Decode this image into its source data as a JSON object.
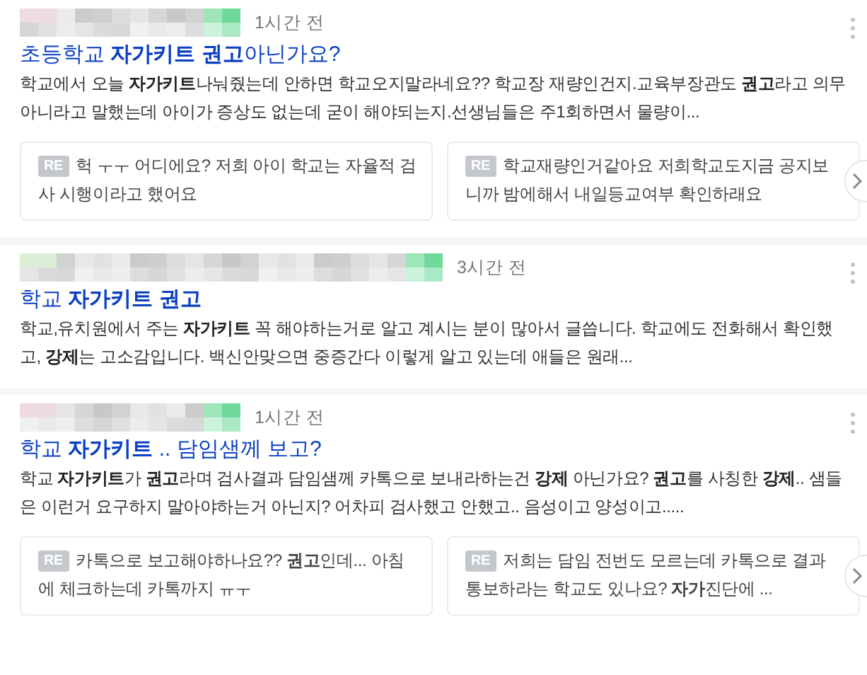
{
  "posts": [
    {
      "time": "1시간 전",
      "title": "초등학교 **자가키트 권고**아닌가요?",
      "snippet": "학교에서 오늘 **자가키트**나눠줬는데 안하면 학교오지말라네요?? 학교장 재량인건지.교육부장관도 **권고**라고 의무아니라고 말했는데 아이가 증상도 없는데 굳이 해야되는지.선생님들은 주1회하면서 물량이...",
      "replies": [
        {
          "badge": "RE",
          "text": "헉 ㅜㅜ 어디에요? 저희 아이 학교는 자율적 검사 시행이라고 했어요"
        },
        {
          "badge": "RE",
          "text": "학교재량인거같아요 저희학교도지금 공지보니까 밤에해서 내일등교여부 확인하래요"
        }
      ]
    },
    {
      "time": "3시간 전",
      "title": "학교 **자가키트 권고**",
      "snippet": "학교,유치원에서 주는 **자가키트** 꼭 해야하는거로 알고 계시는 분이 많아서 글씁니다. 학교에도 전화해서 확인했고, **강제**는 고소감입니다. 백신안맞으면 중증간다 이렇게 알고 있는데 애들은 원래..."
    },
    {
      "time": "1시간 전",
      "title": "학교 **자가키트** .. 담임샘께 보고?",
      "snippet": "학교 **자가키트**가 **권고**라며 검사결과 담임샘께 카톡으로 보내라하는건 **강제** 아닌가요? **권고**를 사칭한 **강제**.. 샘들은 이런거 요구하지 말아야하는거 아닌지? 어차피 검사했고 안했고.. 음성이고 양성이고.....",
      "replies": [
        {
          "badge": "RE",
          "text": "카톡으로 보고해야하나요?? **권고**인데... 아침에 체크하는데 카톡까지 ㅠㅜ"
        },
        {
          "badge": "RE",
          "text": "저희는 담임 전번도 모르는데 카톡으로 결과 통보하라는 학교도 있나요? **자가**진단에 ..."
        }
      ]
    }
  ]
}
